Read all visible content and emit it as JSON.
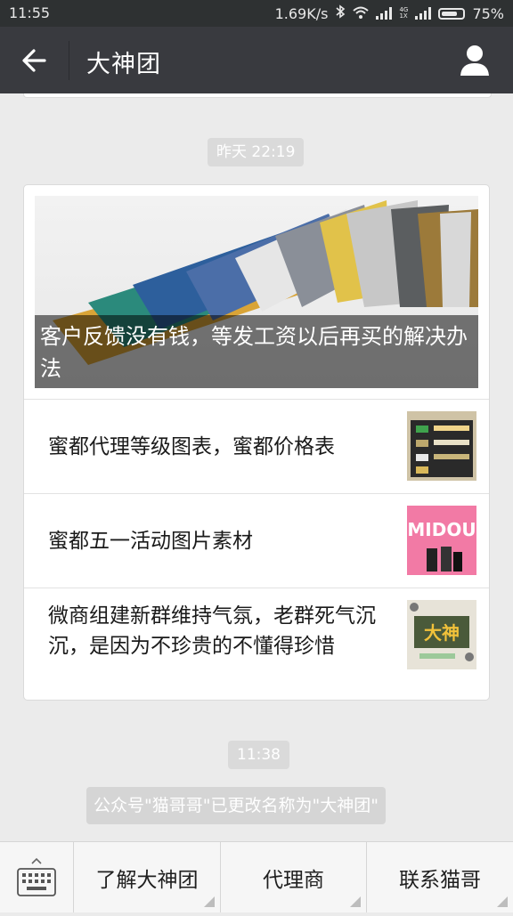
{
  "status_bar": {
    "time": "11:55",
    "net_speed": "1.69K/s",
    "battery": "75%",
    "battery_level": 0.75,
    "network_label": "4G 1X"
  },
  "header": {
    "title": "大神团",
    "back_icon": "arrow-left-icon",
    "profile_icon": "user-icon"
  },
  "chat": {
    "timestamp_1": "昨天 22:19",
    "article_card": {
      "hero_title": "客户反馈没有钱，等发工资以后再买的解决办法",
      "items": [
        {
          "title": "蜜都代理等级图表，蜜都价格表"
        },
        {
          "title": "蜜都五一活动图片素材",
          "thumb_text": "MIDOU"
        },
        {
          "title": "微商组建新群维持气氛，老群死气沉沉，是因为不珍贵的不懂得珍惜",
          "thumb_text": "大神"
        }
      ]
    },
    "timestamp_2": "11:38",
    "system_message": "公众号\"猫哥哥\"已更改名称为\"大神团\""
  },
  "bottom_menu": {
    "keyboard_icon": "keyboard-icon",
    "items": [
      {
        "label": "了解大神团"
      },
      {
        "label": "代理商"
      },
      {
        "label": "联系猫哥"
      }
    ]
  },
  "colors": {
    "nav_bg": "#393a3f",
    "status_bg": "#2e3132",
    "chat_bg": "#ebebeb",
    "timestamp_bg": "#dadada"
  }
}
